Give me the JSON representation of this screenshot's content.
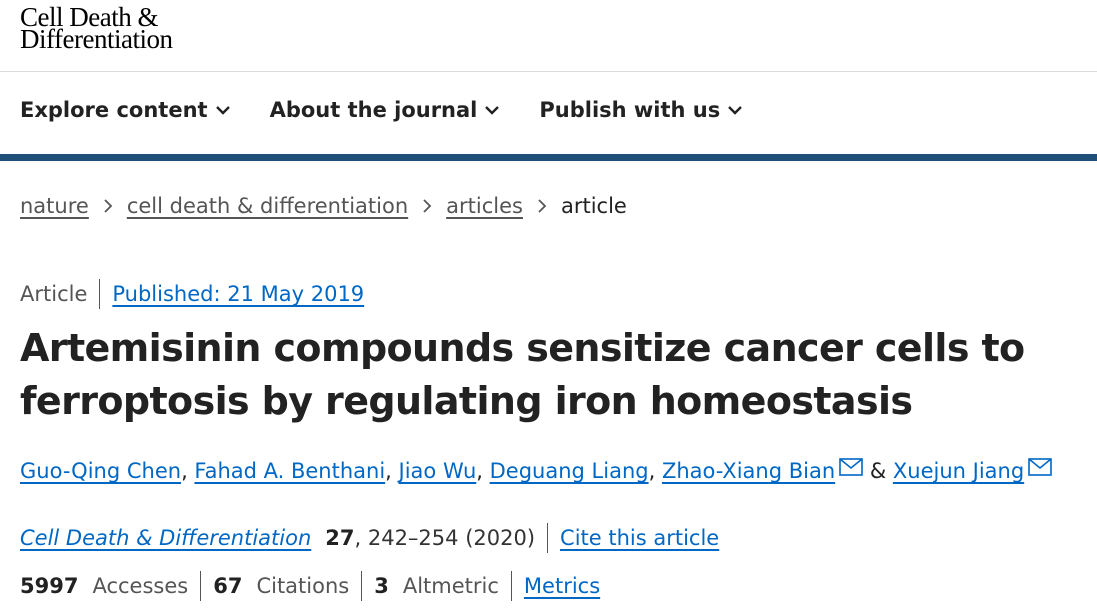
{
  "logo": {
    "line1": "Cell Death &",
    "line2": "Differentiation"
  },
  "nav": [
    {
      "label": "Explore content"
    },
    {
      "label": "About the journal"
    },
    {
      "label": "Publish with us"
    }
  ],
  "breadcrumb": [
    {
      "label": "nature"
    },
    {
      "label": "cell death & differentiation"
    },
    {
      "label": "articles"
    },
    {
      "label": "article"
    }
  ],
  "article": {
    "type": "Article",
    "published": "Published: 21 May 2019",
    "title": "Artemisinin compounds sensitize cancer cells to ferroptosis by regulating iron homeostasis",
    "authors": [
      {
        "name": "Guo-Qing Chen"
      },
      {
        "name": "Fahad A. Benthani"
      },
      {
        "name": "Jiao Wu"
      },
      {
        "name": "Deguang Liang"
      },
      {
        "name": "Zhao-Xiang Bian"
      },
      {
        "name": "Xuejun Jiang"
      }
    ],
    "journal": "Cell Death & Differentiation",
    "volume": "27",
    "pages_year": ", 242–254 (2020)",
    "cite_label": "Cite this article",
    "stats": {
      "accesses_value": "5997",
      "accesses_label": "Accesses",
      "citations_value": "67",
      "citations_label": "Citations",
      "altmetric_value": "3",
      "altmetric_label": "Altmetric",
      "metrics_label": "Metrics"
    }
  },
  "colors": {
    "link": "#0067c5",
    "bar": "#1f4e79",
    "text": "#222222"
  }
}
